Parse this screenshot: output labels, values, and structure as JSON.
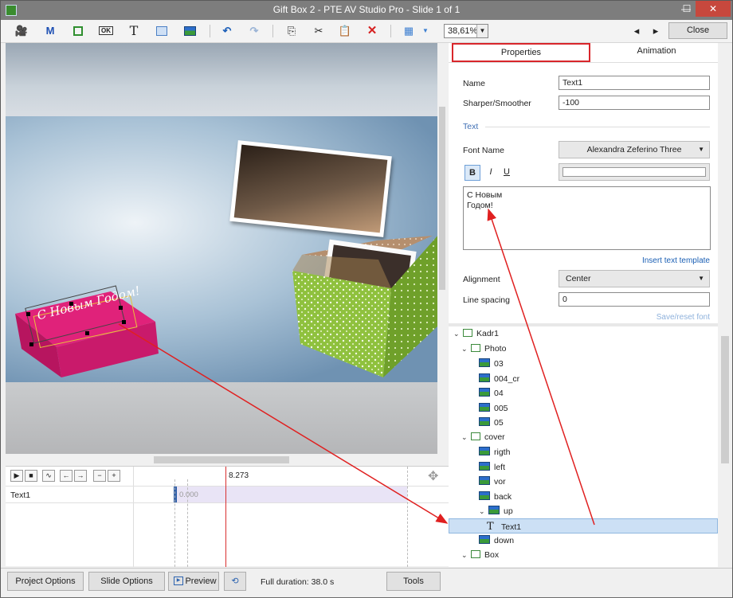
{
  "window": {
    "title": "Gift Box 2 - PTE AV Studio Pro - Slide 1 of 1",
    "min_glyph": "—",
    "max_glyph": "☐",
    "close_glyph": "✕"
  },
  "toolbar": {
    "zoom_value": "38,61%",
    "close_label": "Close",
    "prev_glyph": "◂",
    "next_glyph": "▸",
    "icons": [
      "camera-icon",
      "mask-icon",
      "frame-icon",
      "button-icon",
      "text-icon",
      "rectangle-icon",
      "image-icon",
      "undo-icon",
      "redo-icon",
      "copy-icon",
      "cut-icon",
      "paste-icon",
      "delete-icon",
      "grid-icon"
    ]
  },
  "canvas": {
    "gift_text": "С Новым Годом!"
  },
  "timeline": {
    "time_marker": "8.273",
    "track_label": "Text1",
    "track_start": "0.000"
  },
  "properties": {
    "tab_properties": "Properties",
    "tab_animation": "Animation",
    "name_label": "Name",
    "name_value": "Text1",
    "sharper_label": "Sharper/Smoother",
    "sharper_value": "-100",
    "text_section": "Text",
    "font_name_label": "Font Name",
    "font_name_value": "Alexandra Zeferino Three",
    "bold_label": "B",
    "italic_label": "I",
    "underline_label": "U",
    "text_line1": "С Новым",
    "text_line2": "Годом!",
    "insert_template": "Insert text template",
    "alignment_label": "Alignment",
    "alignment_value": "Center",
    "line_spacing_label": "Line spacing",
    "line_spacing_value": "0",
    "save_reset_font": "Save/reset font"
  },
  "tree": [
    {
      "label": "Kadr1",
      "type": "group",
      "expanded": true
    },
    {
      "label": "Photo",
      "type": "group",
      "expanded": true
    },
    {
      "label": "03",
      "type": "image"
    },
    {
      "label": "004_cr",
      "type": "image"
    },
    {
      "label": "04",
      "type": "image"
    },
    {
      "label": "005",
      "type": "image"
    },
    {
      "label": "05",
      "type": "image"
    },
    {
      "label": "cover",
      "type": "group",
      "expanded": true
    },
    {
      "label": "rigth",
      "type": "image"
    },
    {
      "label": "left",
      "type": "image"
    },
    {
      "label": "vor",
      "type": "image"
    },
    {
      "label": "back",
      "type": "image"
    },
    {
      "label": "up",
      "type": "image",
      "expanded": true
    },
    {
      "label": "Text1",
      "type": "text",
      "selected": true
    },
    {
      "label": "down",
      "type": "image"
    },
    {
      "label": "Box",
      "type": "group",
      "expanded": true
    }
  ],
  "bottom": {
    "project_options": "Project Options",
    "slide_options": "Slide Options",
    "preview": "Preview",
    "full_duration": "Full duration: 38.0 s",
    "tools": "Tools"
  },
  "colors": {
    "highlight_box": "#d9262b",
    "arrow": "#e02020",
    "selection": "#cce0f5",
    "giftbox": "#e0227a",
    "box_green": "#8fc13e"
  }
}
